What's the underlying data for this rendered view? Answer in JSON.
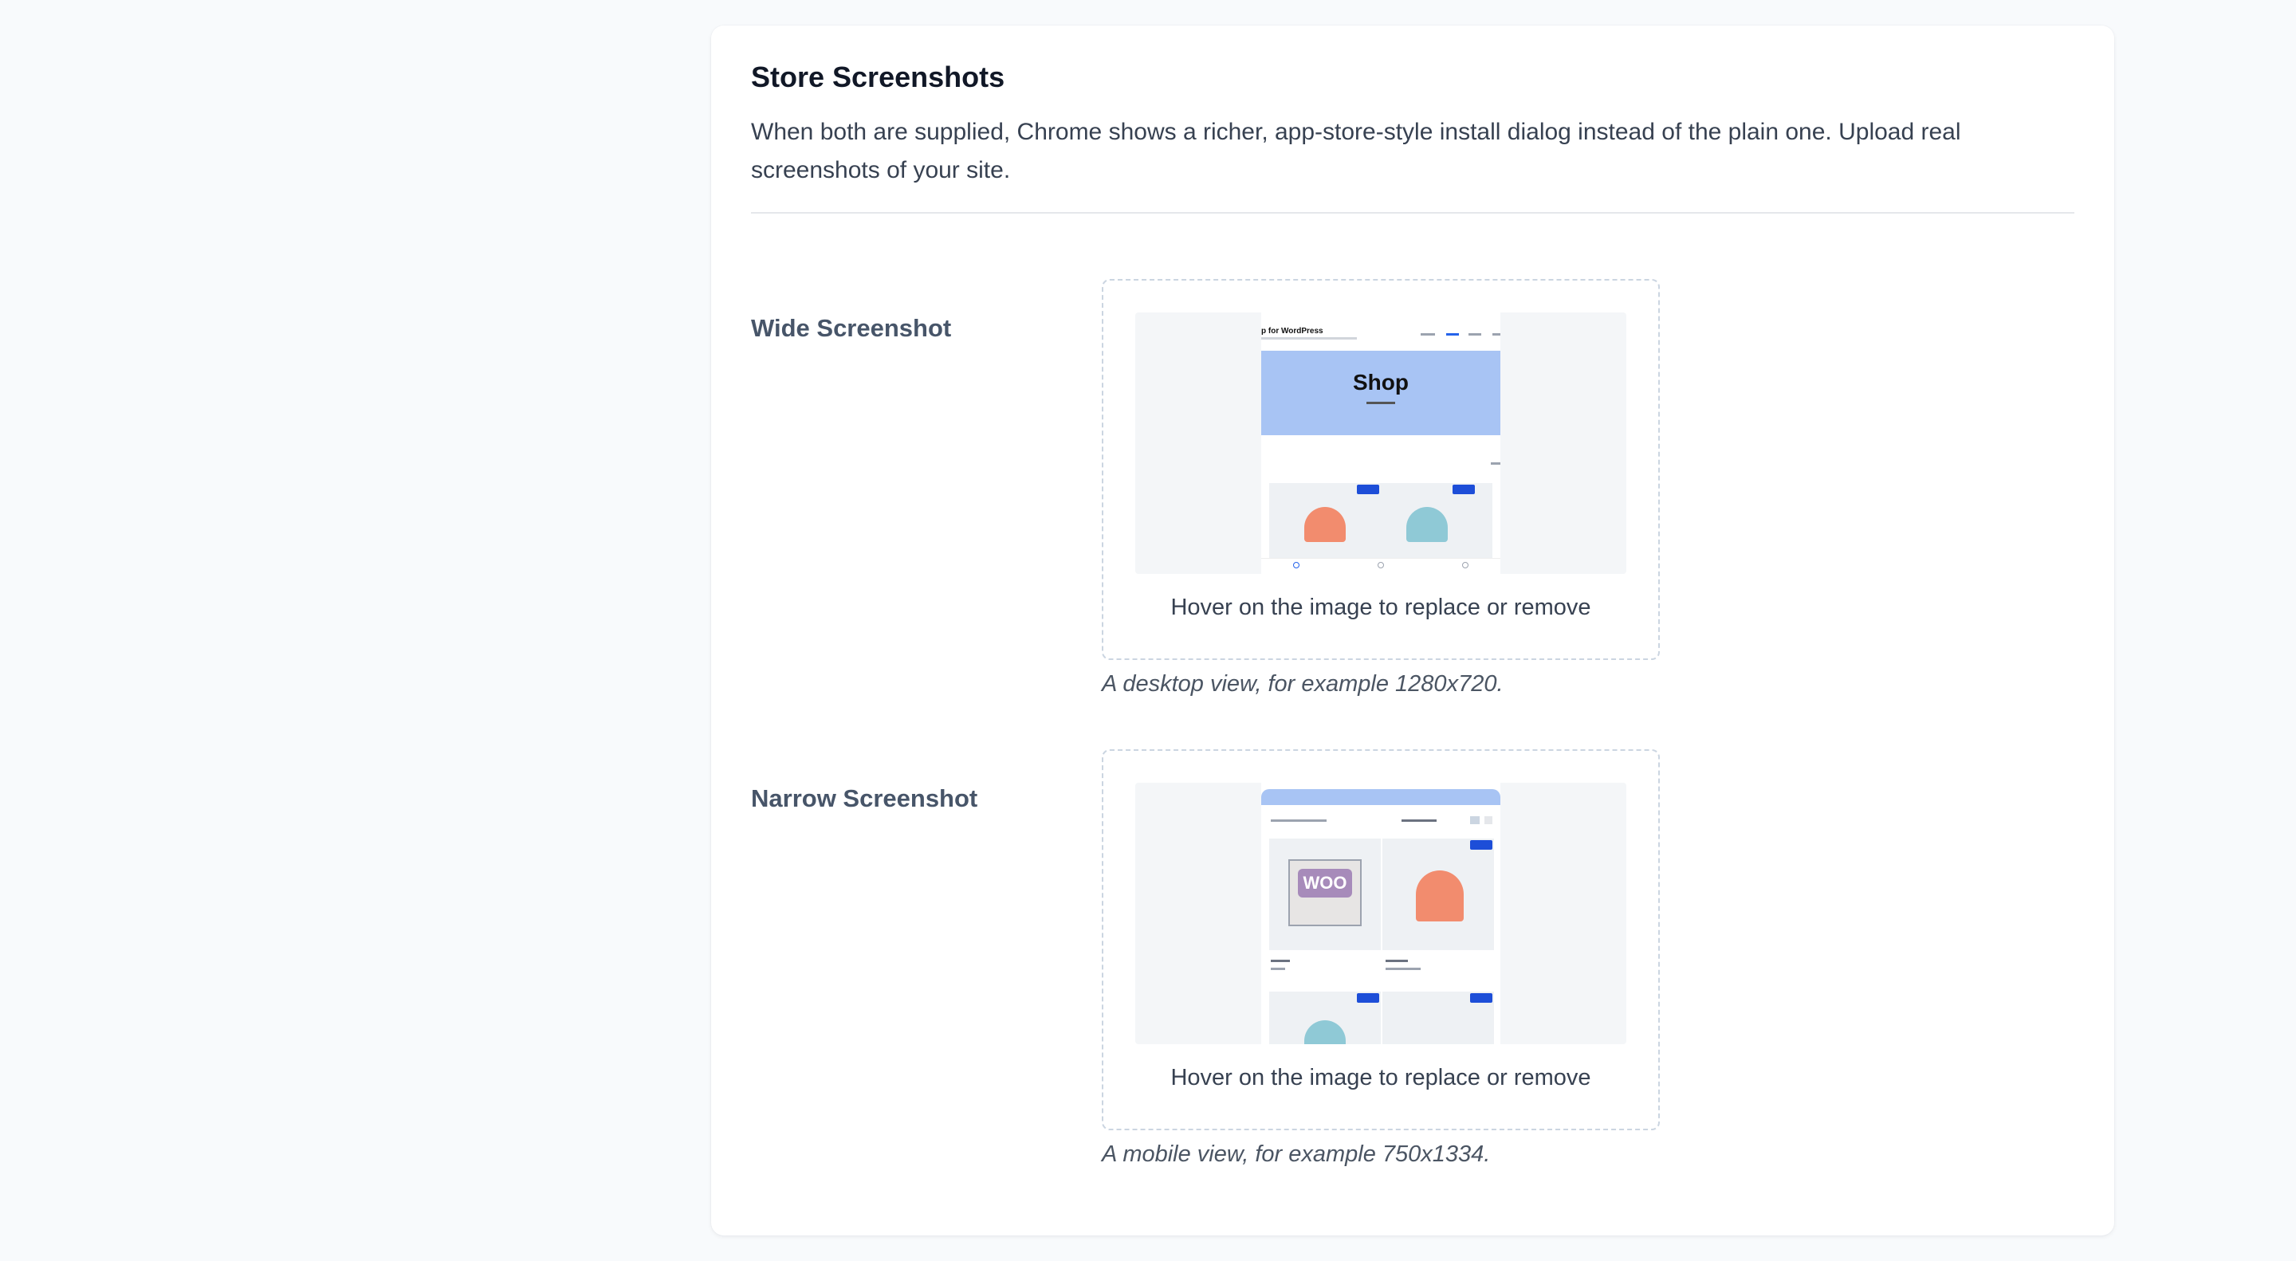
{
  "section": {
    "title": "Store Screenshots",
    "description": "When both are supplied, Chrome shows a richer, app-store-style install dialog instead of the plain one. Upload real screenshots of your site."
  },
  "fields": {
    "wide": {
      "label": "Wide Screenshot",
      "hint": "Hover on the image to replace or remove",
      "help": "A desktop view, for example 1280x720."
    },
    "narrow": {
      "label": "Narrow Screenshot",
      "hint": "Hover on the image to replace or remove",
      "help": "A mobile view, for example 750x1334."
    }
  },
  "wide_preview": {
    "site_name": "p for WordPress",
    "hero_title": "Shop"
  },
  "narrow_preview": {
    "logo_text": "WOO"
  },
  "colors": {
    "hero_blue": "#a8c4f4",
    "badge_blue": "#1d4ed8",
    "beanie_orange": "#f28c6e",
    "beanie_teal": "#8fc9d6"
  }
}
